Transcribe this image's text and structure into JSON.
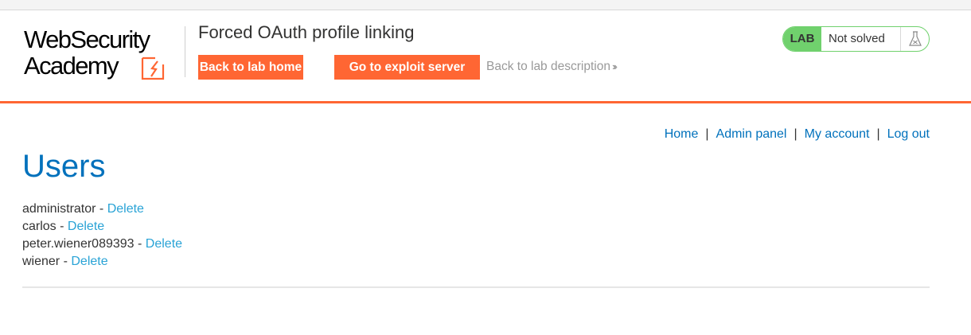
{
  "logo": {
    "line1": "WebSecurity",
    "line2": "Academy"
  },
  "lab": {
    "title": "Forced OAuth profile linking",
    "back_home": "Back to lab home",
    "exploit_server": "Go to exploit server",
    "back_description": "Back to lab description",
    "status_badge": "LAB",
    "status_text": "Not solved"
  },
  "nav": {
    "home": "Home",
    "admin_panel": "Admin panel",
    "my_account": "My account",
    "log_out": "Log out",
    "separator": "|"
  },
  "page": {
    "heading": "Users"
  },
  "users": [
    {
      "name": "administrator",
      "sep": " - ",
      "action": "Delete"
    },
    {
      "name": "carlos",
      "sep": " - ",
      "action": "Delete"
    },
    {
      "name": "peter.wiener089393",
      "sep": " - ",
      "action": "Delete"
    },
    {
      "name": "wiener",
      "sep": " - ",
      "action": "Delete"
    }
  ],
  "colors": {
    "brand_orange": "#ff6633",
    "link_blue": "#0071bc",
    "delete_link": "#29a3d6",
    "status_green": "#70d16d"
  }
}
